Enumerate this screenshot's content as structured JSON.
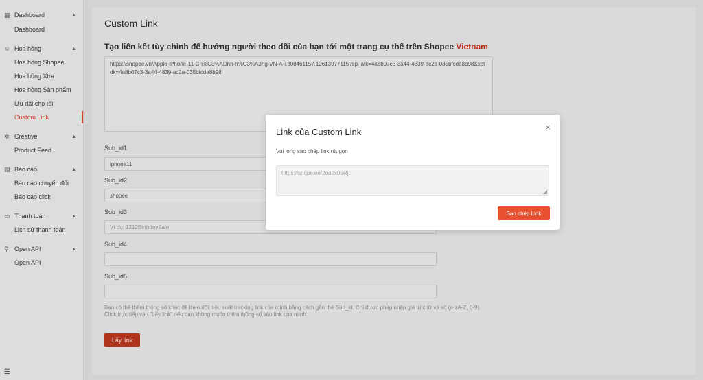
{
  "sidebar": {
    "groups": [
      {
        "label": "Dashboard",
        "icon": "grid-icon",
        "items": [
          {
            "label": "Dashboard"
          }
        ]
      },
      {
        "label": "Hoa hồng",
        "icon": "user-icon",
        "items": [
          {
            "label": "Hoa hồng Shopee"
          },
          {
            "label": "Hoa hồng Xtra"
          },
          {
            "label": "Hoa hồng Sản phẩm"
          },
          {
            "label": "Ưu đãi cho tôi"
          },
          {
            "label": "Custom Link"
          }
        ]
      },
      {
        "label": "Creative",
        "icon": "gear-icon",
        "items": [
          {
            "label": "Product Feed"
          }
        ]
      },
      {
        "label": "Báo cáo",
        "icon": "report-icon",
        "items": [
          {
            "label": "Báo cáo chuyển đổi"
          },
          {
            "label": "Báo cáo click"
          }
        ]
      },
      {
        "label": "Thanh toán",
        "icon": "wallet-icon",
        "items": [
          {
            "label": "Lịch sử thanh toán"
          }
        ]
      },
      {
        "label": "Open API",
        "icon": "api-icon",
        "items": [
          {
            "label": "Open API"
          }
        ]
      }
    ]
  },
  "main": {
    "title": "Custom Link",
    "subtitle_prefix": "Tạo liên kết tùy chỉnh để hướng người theo dõi của bạn tới một trang cụ thể trên Shopee ",
    "subtitle_brand": "Vietnam",
    "url_value": "https://shopee.vn/Apple-iPhone-11-Ch%C3%ADnh-h%C3%A3ng-VN-A-i.308461157.12613977115?sp_atk=4a8b07c3-3a44-4839-ac2a-035bfcda8b98&xptdk=4a8b07c3-3a44-4839-ac2a-035bfcda8b98",
    "fields": [
      {
        "label": "Sub_id1",
        "value": "iphone11",
        "placeholder": ""
      },
      {
        "label": "Sub_id2",
        "value": "shopee",
        "placeholder": ""
      },
      {
        "label": "Sub_id3",
        "value": "",
        "placeholder": "Ví dụ: 1212BirthdaySale"
      },
      {
        "label": "Sub_id4",
        "value": "",
        "placeholder": ""
      },
      {
        "label": "Sub_id5",
        "value": "",
        "placeholder": ""
      }
    ],
    "hint_line1": "Bạn có thể thêm thông số khác để theo dõi hiệu suất tracking link của mình bằng cách gắn thẻ Sub_id. Chỉ được phép nhập giá trị chữ và số (a-zA-Z, 0-9).",
    "hint_line2": "Click trực tiếp vào \"Lấy link\" nếu bạn không muốn thêm thông số vào link của mình.",
    "get_link_label": "Lấy link"
  },
  "modal": {
    "title": "Link của Custom Link",
    "close_icon": "×",
    "message": "Vui lòng sao chép link rút gọn",
    "short_link": "https://shope.ee/2ou2x09Rjt",
    "copy_label": "Sao chép Link"
  },
  "colors": {
    "accent": "#e8512f",
    "brand_text": "#c7301c",
    "active_nav": "#d8442a"
  }
}
